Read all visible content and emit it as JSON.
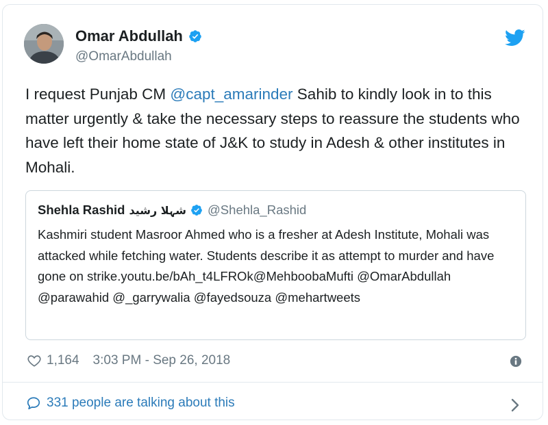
{
  "tweet": {
    "author": {
      "name": "Omar Abdullah",
      "handle": "@OmarAbdullah",
      "verified": true,
      "avatar": "profile-photo"
    },
    "text": {
      "before": "I request Punjab CM ",
      "mention": "@capt_amarinder",
      "after": " Sahib to kindly look in to this matter urgently & take the necessary steps to reassure the students who have left their home state of J&K to study in Adesh & other institutes in Mohali."
    },
    "quoted": {
      "name": "Shehla Rashid",
      "name_urdu": "شہلا رشید",
      "verified": true,
      "handle": "@Shehla_Rashid",
      "text": "Kashmiri student Masroor Ahmed who is a fresher at Adesh Institute, Mohali was attacked while fetching water. Students describe it as attempt to murder and have gone on strike.youtu.be/bAh_t4LFROk@MehboobaMufti @OmarAbdullah @parawahid @_garrywalia @fayedsouza @mehartweets"
    },
    "likes": "1,164",
    "timestamp": "3:03 PM - Sep 26, 2018",
    "talking": "331 people are talking about this"
  },
  "colors": {
    "link": "#2b7bb9",
    "twitter_blue": "#1da1f2",
    "meta": "#697882",
    "border": "#e1e8ed"
  },
  "icons": [
    "verified-badge-icon",
    "twitter-bird-icon",
    "heart-icon",
    "info-icon",
    "speech-bubble-icon",
    "chevron-right-icon"
  ]
}
